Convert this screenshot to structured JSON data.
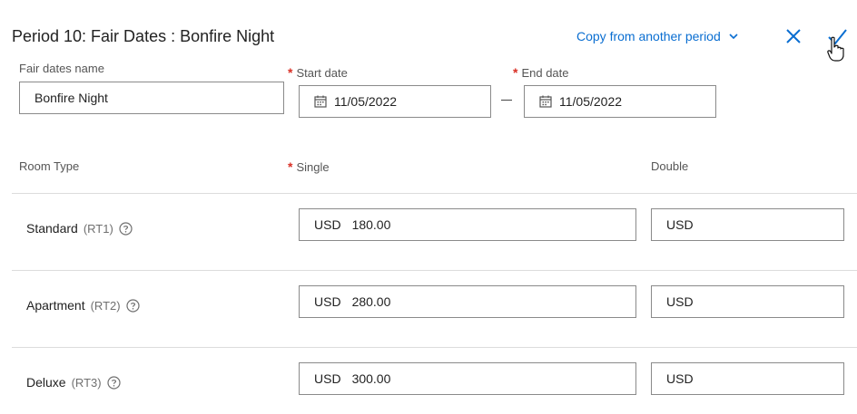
{
  "header": {
    "title": "Period 10: Fair Dates : Bonfire Night",
    "copy_label": "Copy from another period"
  },
  "form": {
    "name_label": "Fair dates name",
    "name_value": "Bonfire Night",
    "start_label": "Start date",
    "start_value": "11/05/2022",
    "end_label": "End date",
    "end_value": "11/05/2022",
    "required_mark": "*"
  },
  "table": {
    "col_room_type": "Room Type",
    "col_single": "Single",
    "col_double": "Double",
    "rows": [
      {
        "name": "Standard",
        "code": "(RT1)",
        "single_currency": "USD",
        "single_value": "180.00",
        "double_currency": "USD",
        "double_value": ""
      },
      {
        "name": "Apartment",
        "code": "(RT2)",
        "single_currency": "USD",
        "single_value": "280.00",
        "double_currency": "USD",
        "double_value": ""
      },
      {
        "name": "Deluxe",
        "code": "(RT3)",
        "single_currency": "USD",
        "single_value": "300.00",
        "double_currency": "USD",
        "double_value": ""
      }
    ]
  },
  "colors": {
    "accent": "#0a6ed1",
    "required": "#d93025",
    "border": "#8a8a8a",
    "divider": "#dcdcdc"
  },
  "icons": [
    "chevron-down-icon",
    "close-icon",
    "check-icon",
    "hand-cursor-icon",
    "calendar-icon",
    "help-icon"
  ]
}
